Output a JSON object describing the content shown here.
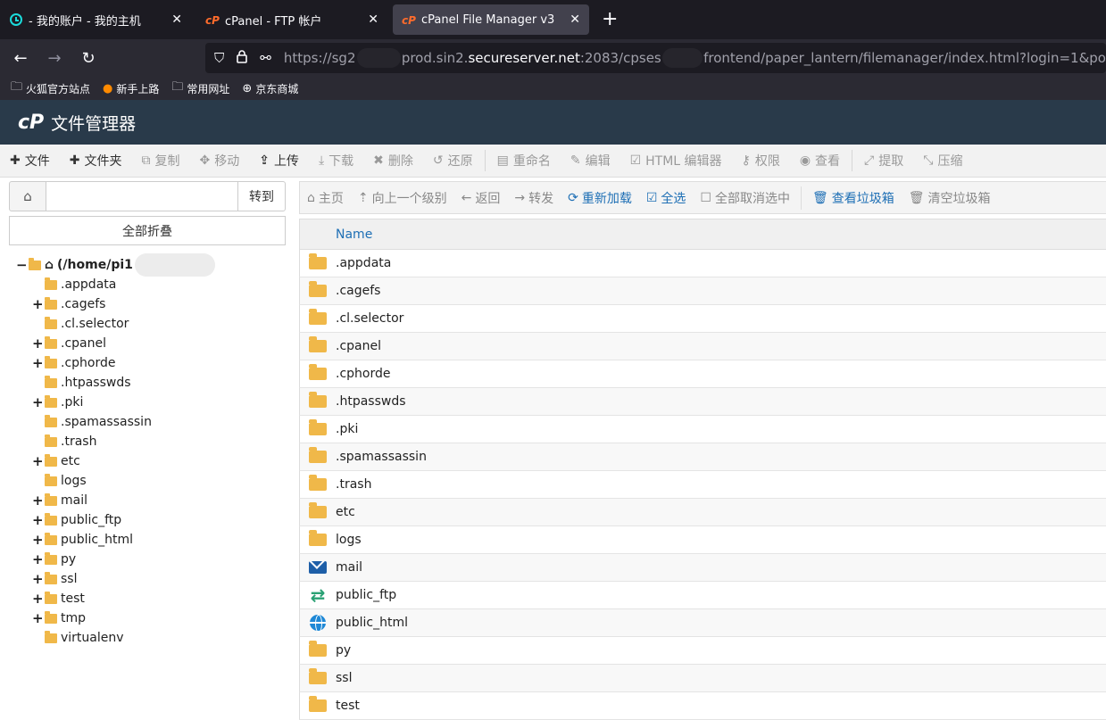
{
  "browser": {
    "tabs": [
      {
        "label": "- 我的账户 - 我的主机",
        "icon": "godaddy-icon",
        "close": "✕"
      },
      {
        "label": "cPanel - FTP 帐户",
        "icon": "cpanel-icon",
        "close": "✕"
      },
      {
        "label": "cPanel File Manager v3",
        "icon": "cpanel-icon",
        "close": "✕"
      }
    ],
    "new_tab": "+",
    "url_prefix": "https://sg2",
    "url_mid1": "prod.sin2.",
    "url_host": "secureserver.net",
    "url_mid2": ":2083/cpses",
    "url_rest": "frontend/paper_lantern/filemanager/index.html?login=1&po",
    "bookmarks": [
      "火狐官方站点",
      "新手上路",
      "常用网址",
      "京东商城"
    ]
  },
  "app": {
    "logo": "cP",
    "title": "文件管理器"
  },
  "toolbar": {
    "file": "文件",
    "folder": "文件夹",
    "copy": "复制",
    "move": "移动",
    "upload": "上传",
    "download": "下载",
    "delete": "删除",
    "restore": "还原",
    "rename": "重命名",
    "edit": "编辑",
    "html_editor": "HTML 编辑器",
    "permissions": "权限",
    "view": "查看",
    "extract": "提取",
    "compress": "压缩"
  },
  "left": {
    "path_value": "",
    "go": "转到",
    "collapse_all": "全部折叠",
    "root": "(/home/pi1",
    "tree": [
      {
        "label": ".appdata",
        "expandable": false
      },
      {
        "label": ".cagefs",
        "expandable": true
      },
      {
        "label": ".cl.selector",
        "expandable": false
      },
      {
        "label": ".cpanel",
        "expandable": true
      },
      {
        "label": ".cphorde",
        "expandable": true
      },
      {
        "label": ".htpasswds",
        "expandable": false
      },
      {
        "label": ".pki",
        "expandable": true
      },
      {
        "label": ".spamassassin",
        "expandable": false
      },
      {
        "label": ".trash",
        "expandable": false
      },
      {
        "label": "etc",
        "expandable": true
      },
      {
        "label": "logs",
        "expandable": false
      },
      {
        "label": "mail",
        "expandable": true
      },
      {
        "label": "public_ftp",
        "expandable": true
      },
      {
        "label": "public_html",
        "expandable": true
      },
      {
        "label": "py",
        "expandable": true
      },
      {
        "label": "ssl",
        "expandable": true
      },
      {
        "label": "test",
        "expandable": true
      },
      {
        "label": "tmp",
        "expandable": true
      },
      {
        "label": "virtualenv",
        "expandable": false
      }
    ]
  },
  "right_toolbar": {
    "home": "主页",
    "up": "向上一个级别",
    "back": "返回",
    "forward": "转发",
    "reload": "重新加载",
    "select_all": "全选",
    "deselect_all": "全部取消选中",
    "view_trash": "查看垃圾箱",
    "empty_trash": "清空垃圾箱"
  },
  "table": {
    "header": "Name",
    "rows": [
      {
        "name": ".appdata",
        "icon": "folder-icon"
      },
      {
        "name": ".cagefs",
        "icon": "folder-icon"
      },
      {
        "name": ".cl.selector",
        "icon": "folder-icon"
      },
      {
        "name": ".cpanel",
        "icon": "folder-icon"
      },
      {
        "name": ".cphorde",
        "icon": "folder-icon"
      },
      {
        "name": ".htpasswds",
        "icon": "folder-icon"
      },
      {
        "name": ".pki",
        "icon": "folder-icon"
      },
      {
        "name": ".spamassassin",
        "icon": "folder-icon"
      },
      {
        "name": ".trash",
        "icon": "folder-icon"
      },
      {
        "name": "etc",
        "icon": "folder-icon"
      },
      {
        "name": "logs",
        "icon": "folder-icon"
      },
      {
        "name": "mail",
        "icon": "mail-icon"
      },
      {
        "name": "public_ftp",
        "icon": "ftp-icon"
      },
      {
        "name": "public_html",
        "icon": "globe-icon"
      },
      {
        "name": "py",
        "icon": "folder-icon"
      },
      {
        "name": "ssl",
        "icon": "folder-icon"
      },
      {
        "name": "test",
        "icon": "folder-icon"
      }
    ]
  },
  "colors": {
    "header_bg": "#293a4a",
    "accent": "#1e6fb5",
    "folder": "#f0b849"
  }
}
